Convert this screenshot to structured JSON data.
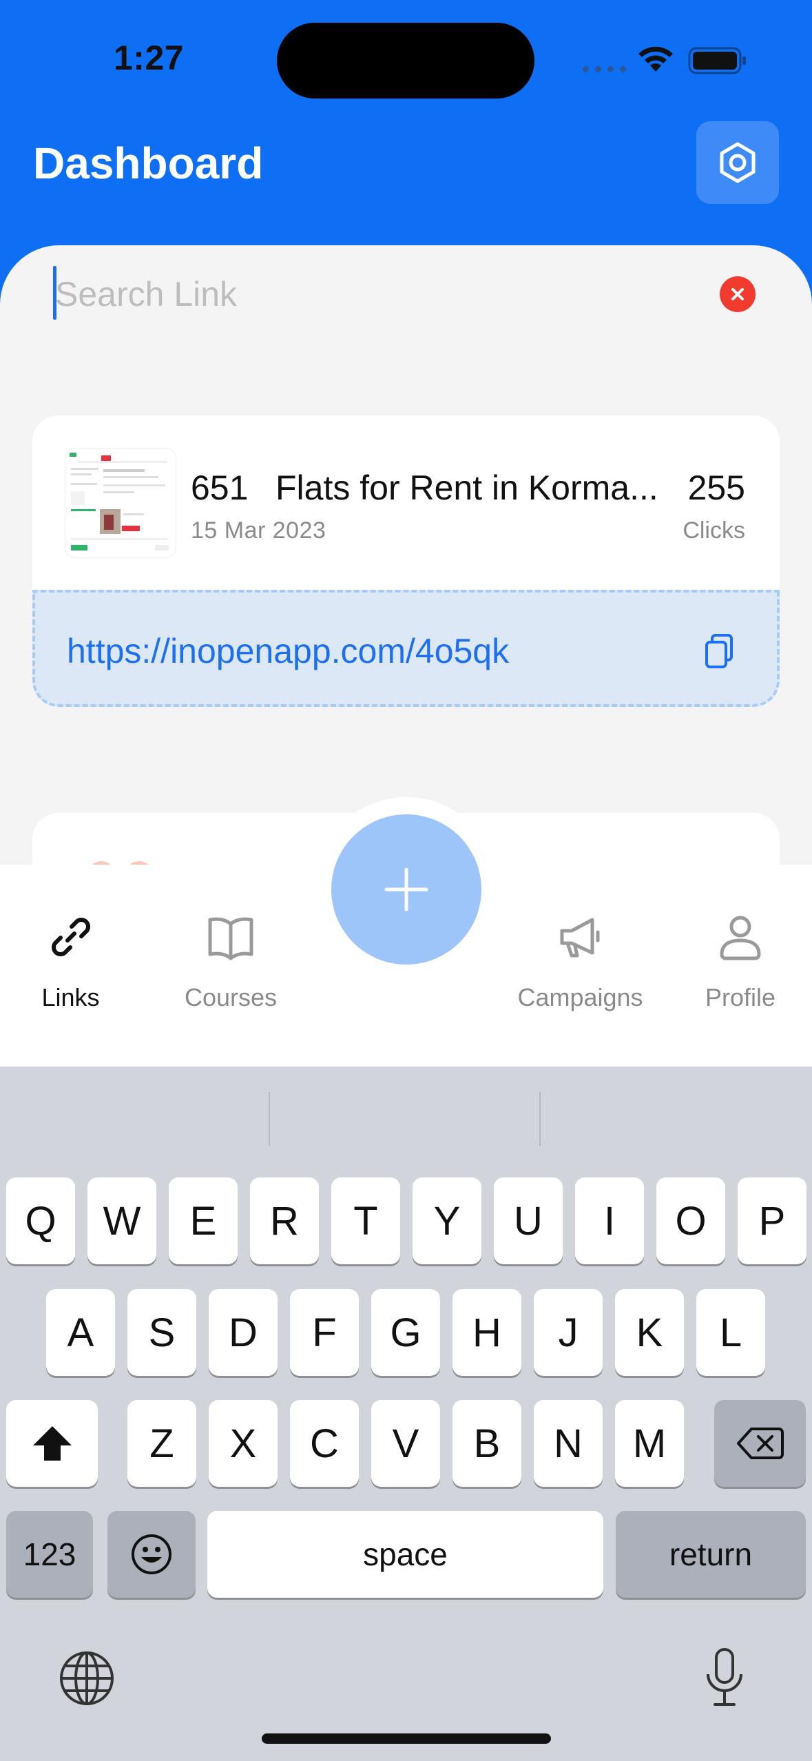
{
  "status_bar": {
    "time": "1:27"
  },
  "header": {
    "title": "Dashboard"
  },
  "search": {
    "placeholder": "Search Link",
    "value": ""
  },
  "link_card": {
    "id": "651",
    "title": "Flats for Rent in Korma...",
    "date": "15 Mar 2023",
    "clicks": "255",
    "clicks_label": "Clicks",
    "url": "https://inopenapp.com/4o5qk"
  },
  "tabs": [
    {
      "label": "Links",
      "icon": "link-icon",
      "active": true
    },
    {
      "label": "Courses",
      "icon": "book-icon",
      "active": false
    },
    {
      "label": "Campaigns",
      "icon": "megaphone-icon",
      "active": false
    },
    {
      "label": "Profile",
      "icon": "person-icon",
      "active": false
    }
  ],
  "keyboard": {
    "row1": [
      "Q",
      "W",
      "E",
      "R",
      "T",
      "Y",
      "U",
      "I",
      "O",
      "P"
    ],
    "row2": [
      "A",
      "S",
      "D",
      "F",
      "G",
      "H",
      "J",
      "K",
      "L"
    ],
    "row3": [
      "Z",
      "X",
      "C",
      "V",
      "B",
      "N",
      "M"
    ],
    "numbers_label": "123",
    "space_label": "space",
    "return_label": "return"
  },
  "colors": {
    "brand_blue": "#0E6FF5",
    "link_blue": "#1E6FF0",
    "fab_blue": "#9EC5FA",
    "clear_red": "#F23B2F"
  }
}
